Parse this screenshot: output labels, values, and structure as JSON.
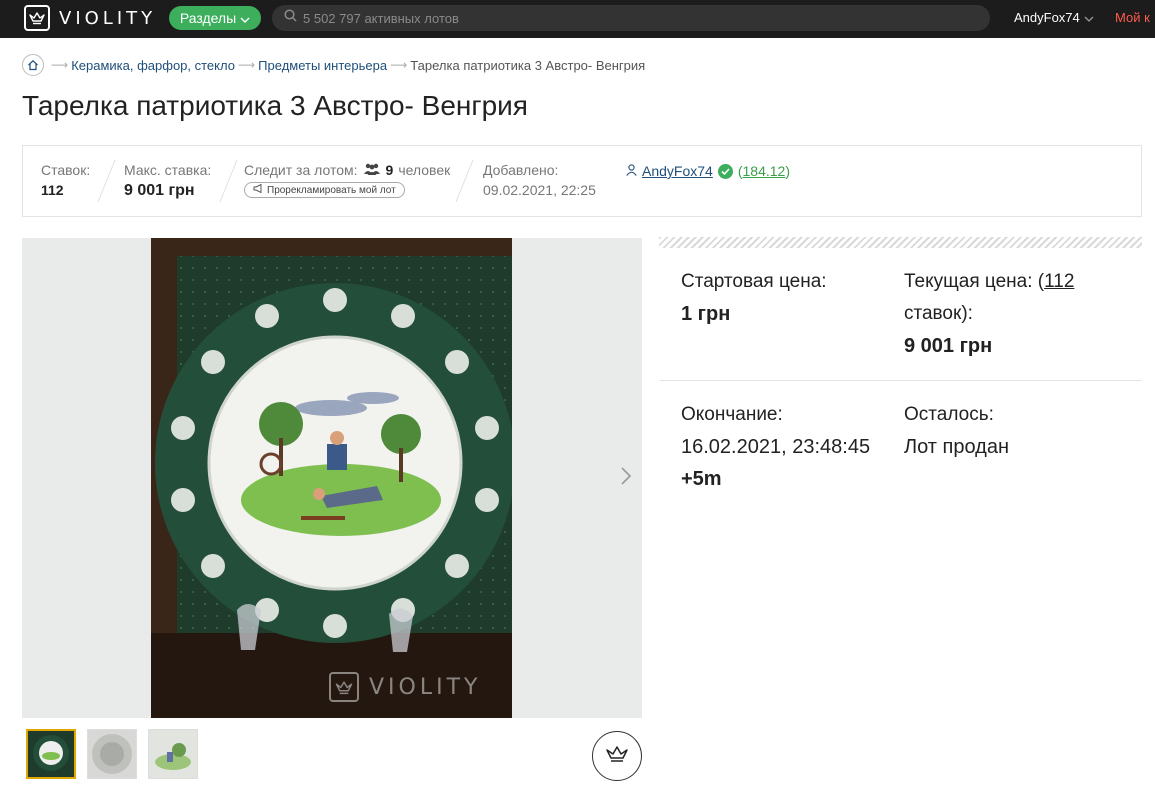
{
  "header": {
    "logo_text": "VIOLITY",
    "sections_label": "Разделы",
    "search_placeholder": "5 502 797 активных лотов",
    "username": "AndyFox74",
    "my_link": "Мой к"
  },
  "breadcrumb": {
    "items": [
      "Керамика, фарфор, стекло",
      "Предметы интерьера"
    ],
    "current": "Тарелка патриотика 3 Австро- Венгрия"
  },
  "title": "Тарелка патриотика 3 Австро- Венгрия",
  "info": {
    "bids_label": "Ставок:",
    "bids_value": "112",
    "max_bid_label": "Макс. ставка:",
    "max_bid_value": "9 001 грн",
    "watchers_label": "Следит за лотом:",
    "watchers_count": "9",
    "watchers_unit": "человек",
    "promo_label": "Прорекламировать мой лот",
    "added_label": "Добавлено:",
    "added_value": "09.02.2021, 22:25",
    "seller_name": "AndyFox74",
    "seller_rating": "184.12"
  },
  "gallery": {
    "watermark_text": "VIOLITY",
    "thumb_count": 3
  },
  "price_panel": {
    "start_label": "Стартовая цена:",
    "start_value": "1 грн",
    "current_label_prefix": "Текущая цена: (",
    "current_bids_link": "112",
    "current_label_suffix": "ставок):",
    "current_value": "9 001 грн",
    "end_label": "Окончание:",
    "end_value": "16.02.2021, 23:48:45",
    "end_extra": "+5m",
    "remaining_label": "Осталось:",
    "remaining_value": "Лот продан"
  },
  "colors": {
    "accent_green": "#3cae5c",
    "header_bg": "#1c1c1c",
    "link_blue": "#1f4f7a",
    "my_link_red": "#ff5a4a"
  }
}
